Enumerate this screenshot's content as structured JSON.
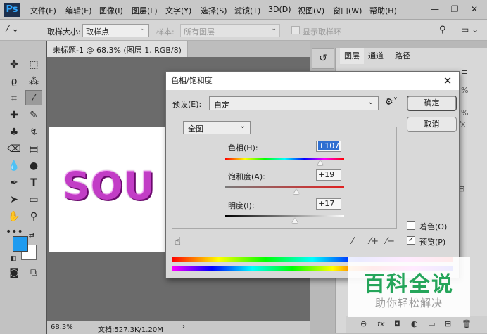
{
  "app": {
    "logo": "Ps"
  },
  "menu": [
    "文件(F)",
    "编辑(E)",
    "图像(I)",
    "图层(L)",
    "文字(Y)",
    "选择(S)",
    "滤镜(T)",
    "3D(D)",
    "视图(V)",
    "窗口(W)",
    "帮助(H)"
  ],
  "options": {
    "sample_size_label": "取样大小:",
    "sample_size_value": "取样点",
    "sample_label": "样本:",
    "sample_value": "所有图层",
    "show_ring_label": "显示取样环"
  },
  "document": {
    "tab_title": "未标题-1 @ 68.3% (图层 1, RGB/8) *",
    "canvas_text": "SOU",
    "zoom": "68.3%",
    "doc_info": "文档:527.3K/1.20M"
  },
  "colors": {
    "foreground": "#1e9bf0",
    "background": "#ffffff"
  },
  "panels": {
    "tabs": [
      "图层",
      "通道",
      "路径"
    ]
  },
  "dialog": {
    "title": "色相/饱和度",
    "preset_label": "预设(E):",
    "preset_value": "自定",
    "channel_value": "全图",
    "hue_label": "色相(H):",
    "hue_value": "+107",
    "saturation_label": "饱和度(A):",
    "saturation_value": "+19",
    "lightness_label": "明度(I):",
    "lightness_value": "+17",
    "ok_label": "确定",
    "cancel_label": "取消",
    "colorize_label": "着色(O)",
    "colorize_checked": false,
    "preview_label": "预览(P)",
    "preview_checked": true
  },
  "watermark": {
    "title": "百科全说",
    "subtitle": "助你轻松解决"
  }
}
